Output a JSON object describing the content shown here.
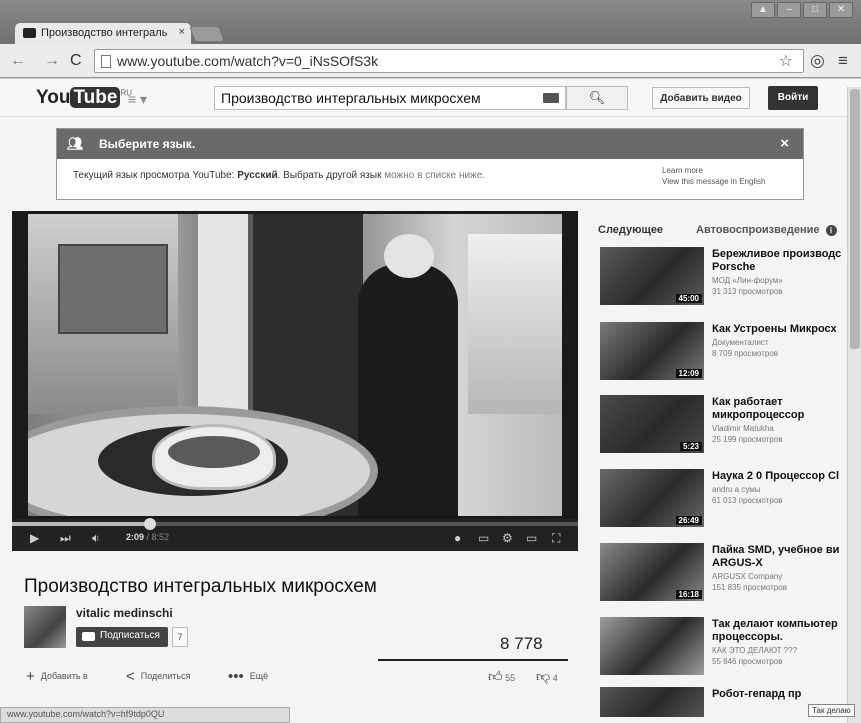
{
  "browser": {
    "tab_title": "Производство интеграль",
    "tab_close": "×",
    "url": "www.youtube.com/watch?v=0_iNsSOfS3k"
  },
  "header": {
    "logo_you": "You",
    "logo_tube": "Tube",
    "logo_region": "RU",
    "search_value": "Производство интергальных микросхем",
    "upload_label": "Добавить видео",
    "signin_label": "Войти"
  },
  "language_banner": {
    "heading": "Выберите язык.",
    "text_before": "Текущий язык просмотра YouTube: ",
    "current_language": "Русский",
    "text_after": ". Выбрать другой язык ",
    "text_muted": "можно в списке ниже.",
    "learn_more": "Learn more",
    "view_english": "View this message in English",
    "close": "×"
  },
  "player": {
    "time_current": "2:09",
    "time_total": " / 8:52",
    "progress_fraction": 0.243
  },
  "video": {
    "title": "Производство интегральных микросхем",
    "channel": "vitalic medinschi",
    "subscribe_label": "Подписаться",
    "subscriber_count": "7",
    "views": "8 778",
    "add_to": "Добавить в",
    "share": "Поделиться",
    "more": "Ещё",
    "likes": "55",
    "dislikes": "4"
  },
  "sidebar": {
    "up_next": "Следующее",
    "autoplay": "Автовоспроизведение",
    "items": [
      {
        "title": "Бережливое производс",
        "title2": "Porsche",
        "channel": "МОД «Лин-форум»",
        "views": "31 313 просмотров",
        "duration": "45:00"
      },
      {
        "title": "Как Устроены Микросх",
        "title2": "",
        "channel": "Документалист",
        "views": "8 709 просмотров",
        "duration": "12:09"
      },
      {
        "title": "Как работает",
        "title2": "микропроцессор",
        "channel": "Vladimir Matukha",
        "views": "25 199 просмотров",
        "duration": "5:23"
      },
      {
        "title": "Наука 2 0 Процессор Cl",
        "title2": "",
        "channel": "andru a сумы",
        "views": "61 013 просмотров",
        "duration": "26:49"
      },
      {
        "title": "Пайка SMD, учебное ви",
        "title2": "ARGUS-X",
        "channel": "ARGUSX Company",
        "views": "151 835 просмотров",
        "duration": "16:18"
      },
      {
        "title": "Так делают компьютер",
        "title2": "процессоры.",
        "channel": "КАК ЭТО ДЕЛАЮТ ???",
        "views": "55 846 просмотров",
        "duration": ""
      },
      {
        "title": "Робот-гепард пр",
        "title2": "",
        "channel": "",
        "views": "",
        "duration": ""
      }
    ]
  },
  "status_url": "www.youtube.com/watch?v=hf9tdp0QU",
  "tooltip": "Так делаю"
}
